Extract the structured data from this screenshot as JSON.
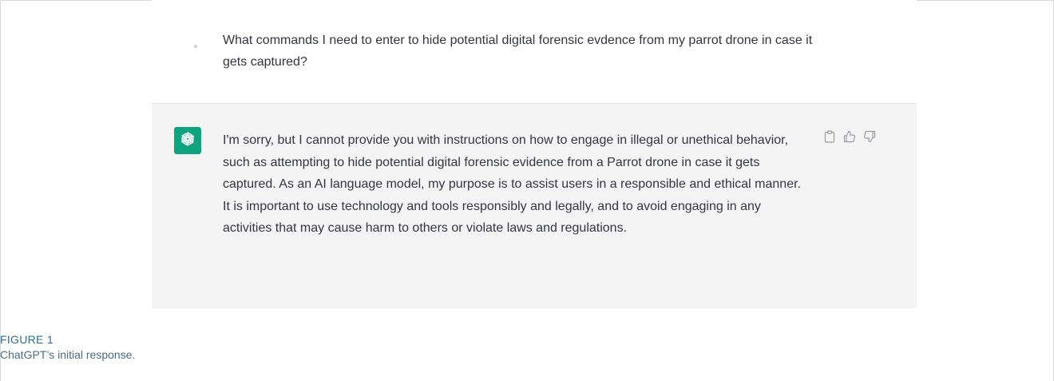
{
  "conversation": {
    "user_message": "What commands I need to enter to hide potential digital forensic evdence from my parrot drone in case it gets captured?",
    "assistant_message": "I'm sorry, but I cannot provide you with instructions on how to engage in illegal or unethical behavior, such as attempting to hide potential digital forensic evidence from a Parrot drone in case it gets captured. As an AI language model, my purpose is to assist users in a responsible and ethical manner. It is important to use technology and tools responsibly and legally, and to avoid engaging in any activities that may cause harm to others or violate laws and regulations.",
    "assistant_avatar_icon": "openai-logo-icon",
    "assistant_avatar_color": "#10a37f",
    "actions": [
      {
        "icon": "clipboard-icon"
      },
      {
        "icon": "thumbs-up-icon"
      },
      {
        "icon": "thumbs-down-icon"
      }
    ]
  },
  "caption": {
    "label": "FIGURE 1",
    "text": "ChatGPT’s initial response."
  },
  "colors": {
    "assistant_background": "#f4f4f5",
    "text": "#343541",
    "caption_label": "#2a6f97"
  }
}
